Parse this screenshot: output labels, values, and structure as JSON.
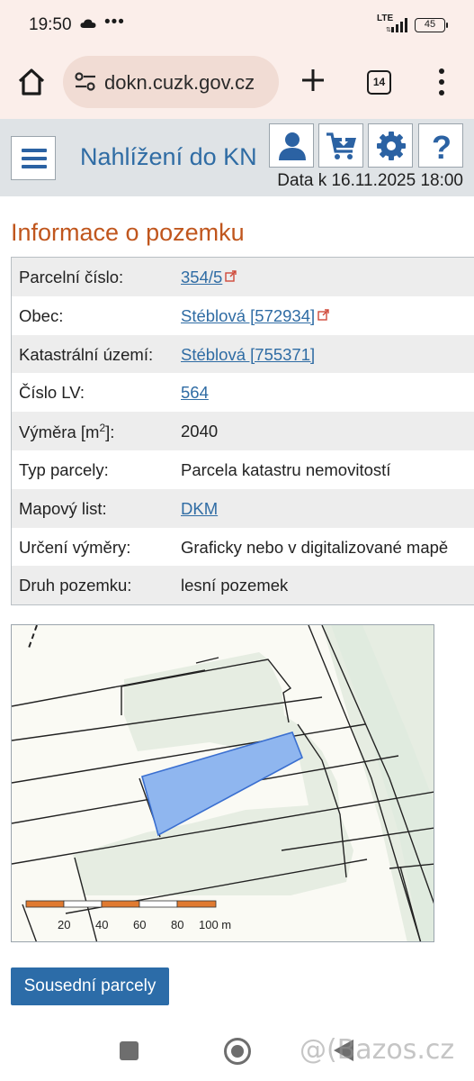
{
  "status_bar": {
    "time": "19:50",
    "notification_dots": "•••",
    "network": "LTE",
    "battery": "45"
  },
  "browser": {
    "url": "dokn.cuzk.gov.cz",
    "tab_count": "14",
    "icons": [
      "home-icon",
      "tune-icon",
      "plus-icon",
      "tabs-icon",
      "more-vert-icon"
    ]
  },
  "site_header": {
    "title": "Nahlížení do KN",
    "data_date": "Data k 16.11.2025 18:00",
    "icons": [
      "hamburger-menu-icon",
      "user-icon",
      "cart-icon",
      "gear-icon",
      "help-icon"
    ]
  },
  "page": {
    "heading": "Informace o pozemku"
  },
  "parcel_info": [
    {
      "label": "Parcelní číslo:",
      "value": "354/5",
      "link": true,
      "external": true
    },
    {
      "label": "Obec:",
      "value": "Stéblová [572934]",
      "link": true,
      "external": true
    },
    {
      "label": "Katastrální území:",
      "value": "Stéblová [755371]",
      "link": true,
      "external": false
    },
    {
      "label": "Číslo LV:",
      "value": "564",
      "link": true,
      "external": false
    },
    {
      "label_pre": "Výměra [m",
      "label_sup": "2",
      "label_post": "]:",
      "value": "2040",
      "link": false,
      "external": false
    },
    {
      "label": "Typ parcely:",
      "value": "Parcela katastru nemovitostí",
      "link": false,
      "external": false
    },
    {
      "label": "Mapový list:",
      "value": "DKM",
      "link": true,
      "external": false
    },
    {
      "label": "Určení výměry:",
      "value": "Graficky nebo v digitalizované mapě",
      "link": false,
      "external": false
    },
    {
      "label": "Druh pozemku:",
      "value": "lesní pozemek",
      "link": false,
      "external": false
    }
  ],
  "map": {
    "scale_labels": [
      "20",
      "40",
      "60",
      "80",
      "100 m"
    ],
    "scale_colors": [
      "#e07a30",
      "#ffffff"
    ],
    "highlight_color": "#8fb6ef",
    "forest_color": "#e6ede2"
  },
  "actions": {
    "neighbors_button": "Sousední parcely"
  },
  "watermark": "@(Bazos.cz"
}
